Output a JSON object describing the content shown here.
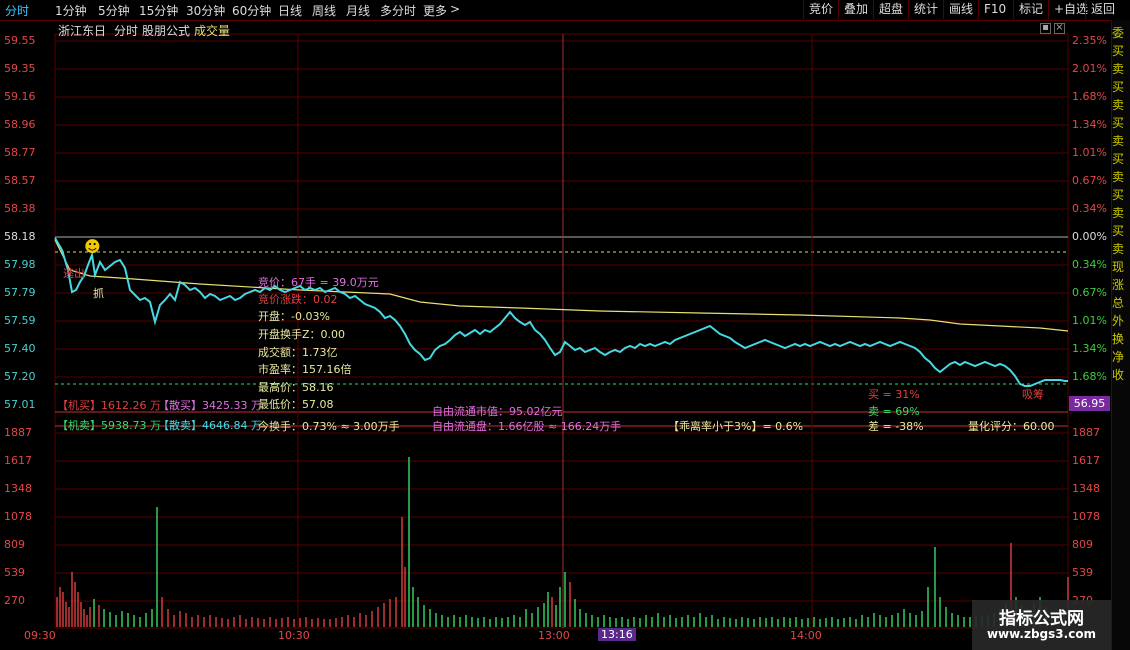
{
  "toolbar": {
    "periods": [
      "分时",
      "1分钟",
      "5分钟",
      "15分钟",
      "30分钟",
      "60分钟",
      "日线",
      "周线",
      "月线",
      "多分时",
      "更多"
    ],
    "more_arrow": ">",
    "right_buttons": [
      "竞价",
      "叠加",
      "超盘",
      "统计",
      "画线",
      "F10",
      "标记",
      "+自选",
      "返回"
    ]
  },
  "title": {
    "stock": "浙江东日",
    "view": "分时",
    "formula": "股朋公式",
    "indicator": "成交量"
  },
  "price_axis": [
    "59.55",
    "59.35",
    "59.16",
    "58.96",
    "58.77",
    "58.57",
    "58.38",
    "58.18",
    "57.98",
    "57.79",
    "57.59",
    "57.40",
    "57.20",
    "57.01"
  ],
  "pct_axis": [
    "2.35%",
    "2.01%",
    "1.68%",
    "1.34%",
    "1.01%",
    "0.67%",
    "0.34%",
    "0.00%",
    "0.34%",
    "0.67%",
    "1.01%",
    "1.34%",
    "1.68%"
  ],
  "volume_axis": [
    "1887",
    "1617",
    "1348",
    "1078",
    "809",
    "539",
    "270"
  ],
  "volume_axis_right": [
    "1887",
    "1617",
    "1348",
    "1078",
    "809",
    "539",
    "270"
  ],
  "current_price": "56.95",
  "time_labels": [
    "09:30",
    "10:30",
    "13:00",
    "13:16",
    "14:00"
  ],
  "overlay": {
    "bid": "竞价：67手 = 39.0万元",
    "bid_note": "竞价涨跌：0.02",
    "open": "开盘：-0.03%",
    "open_turnover": "开盘换手Z：0.00",
    "amount": "成交额：1.73亿",
    "pe": "市盈率：157.16倍",
    "high": "最高价：58.16",
    "low": "最低价：57.08",
    "turnover": "今换手：0.73% ≈ 3.00万手",
    "inst_buy": "【机买】1612.26 万",
    "retail_buy": "【散买】3425.33 万",
    "inst_sell": "【机卖】5938.73 万",
    "retail_sell": "【散卖】4646.84 万",
    "float_value": "自由流通市值：95.02亿元",
    "float_shares": "自由流通盘：1.66亿股 ≈ 166.24万手",
    "deviation": "【乖离率小于3%】= 0.6%",
    "buy_pct": "买 = 31%",
    "sell_pct": "卖 = 69%",
    "diff_pct": "差 = -38%",
    "score": "量化评分：60.00"
  },
  "marks": {
    "left_red": "逃出",
    "grab": "抓",
    "exit": "逃出",
    "absorb": "吸筹",
    "smiley": "☻"
  },
  "right_strip": [
    "委",
    "买",
    "卖",
    "买",
    "卖",
    "买",
    "卖",
    "买",
    "卖",
    "买",
    "卖",
    "买",
    "卖",
    "现",
    "涨",
    "总",
    "外",
    "换",
    "净",
    "收"
  ],
  "watermark": {
    "title": "指标公式网",
    "url": "www.zbgs3.com"
  },
  "colors": {
    "price_line": "#45d9e3",
    "avg_line": "#e8e070",
    "up": "#e34040",
    "down": "#33dd66",
    "grid": "#5a0000"
  }
}
